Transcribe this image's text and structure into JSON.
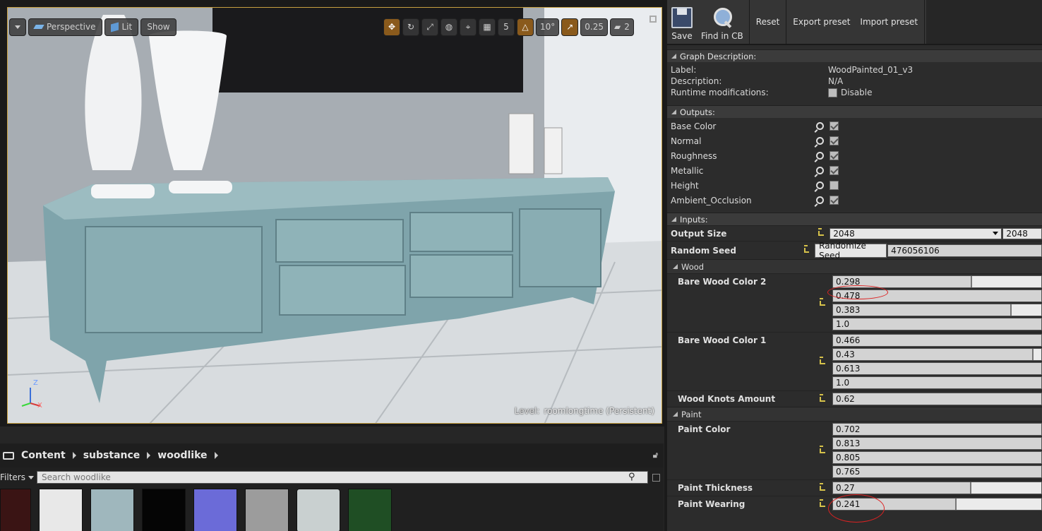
{
  "viewport": {
    "perspective_label": "Perspective",
    "lit_label": "Lit",
    "show_label": "Show",
    "grid_value": "5",
    "angle_value": "10°",
    "scale_value": "0.25",
    "camera_value": "2",
    "level_key": "Level:",
    "level_value": "roomlongtime (Persistent)",
    "axis_z": "Z",
    "axis_x": "X"
  },
  "content_browser": {
    "breadcrumb": [
      "Content",
      "substance",
      "woodlike"
    ],
    "filters_label": "Filters",
    "search_placeholder": "Search woodlike",
    "thumb_colors": [
      "#3a1414",
      "#e8e8e8",
      "#9fb7bd",
      "#050505",
      "#6b6bd8",
      "#9c9c9c",
      "#c9d0d0",
      "#1f4e24"
    ]
  },
  "toolbar": {
    "save_label": "Save",
    "find_label": "Find in CB",
    "reset_label": "Reset",
    "export_label": "Export preset",
    "import_label": "Import preset"
  },
  "graph": {
    "title": "Graph Description:",
    "label_key": "Label:",
    "label_value": "WoodPainted_01_v3",
    "desc_key": "Description:",
    "desc_value": "N/A",
    "runtime_key": "Runtime modifications:",
    "runtime_value": "Disable"
  },
  "outputs": {
    "title": "Outputs:",
    "items": [
      {
        "name": "Base Color",
        "checked": true
      },
      {
        "name": "Normal",
        "checked": true
      },
      {
        "name": "Roughness",
        "checked": true
      },
      {
        "name": "Metallic",
        "checked": true
      },
      {
        "name": "Height",
        "checked": false
      },
      {
        "name": "Ambient_Occlusion",
        "checked": true
      }
    ]
  },
  "inputs": {
    "title": "Inputs:",
    "output_size_label": "Output Size",
    "output_size_a": "2048",
    "output_size_b": "2048",
    "random_seed_label": "Random Seed",
    "randomize_label": "Randomize Seed",
    "seed_value": "476056106",
    "wood_group": "Wood",
    "bare2_label": "Bare Wood Color 2",
    "bare2": [
      "0.298",
      "0.478",
      "0.383",
      "1.0"
    ],
    "bare1_label": "Bare Wood Color 1",
    "bare1": [
      "0.466",
      "0.43",
      "0.613",
      "1.0"
    ],
    "knots_label": "Wood Knots Amount",
    "knots_value": "0.62",
    "paint_group": "Paint",
    "paint_color_label": "Paint Color",
    "paint_color": [
      "0.702",
      "0.813",
      "0.805",
      "0.765"
    ],
    "thickness_label": "Paint Thickness",
    "thickness_value": "0.27",
    "wearing_label": "Paint Wearing",
    "wearing_value": "0.241"
  }
}
